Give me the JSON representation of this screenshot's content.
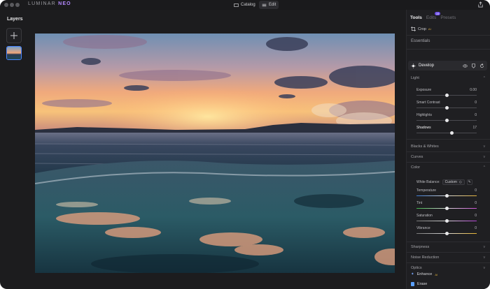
{
  "titlebar": {
    "brand_main": "LUMINAR",
    "brand_accent": "NEO",
    "catalog_label": "Catalog",
    "edit_label": "Edit"
  },
  "layers": {
    "title": "Layers"
  },
  "tabs": {
    "tools": "Tools",
    "edits": "Edits",
    "edits_badge": "15",
    "presets": "Presets"
  },
  "crop": {
    "label": "Crop",
    "ai": "AI"
  },
  "essentials": "Essentials",
  "develop": {
    "label": "Develop"
  },
  "light": {
    "title": "Light",
    "sliders": [
      {
        "label": "Exposure",
        "value": "0.00",
        "fraction": 0.5
      },
      {
        "label": "Smart Contrast",
        "value": "0",
        "fraction": 0.5
      },
      {
        "label": "Highlights",
        "value": "0",
        "fraction": 0.5
      },
      {
        "label": "Shadows",
        "value": "17",
        "fraction": 0.585
      }
    ]
  },
  "groups": {
    "blacks_whites": "Blacks & Whites",
    "curves": "Curves",
    "color": "Color",
    "sharpness": "Sharpness",
    "noise_reduction": "Noise Reduction",
    "optics": "Optics"
  },
  "color": {
    "white_balance_label": "White Balance:",
    "white_balance_value": "Custom",
    "sliders": [
      {
        "label": "Temperature",
        "value": "0",
        "fraction": 0.5
      },
      {
        "label": "Tint",
        "value": "0",
        "fraction": 0.5
      },
      {
        "label": "Saturation",
        "value": "0",
        "fraction": 0.5
      },
      {
        "label": "Vibrance",
        "value": "0",
        "fraction": 0.5
      }
    ]
  },
  "bottom": {
    "enhance": "Enhance",
    "enhance_ai": "AI",
    "erase": "Erase"
  },
  "colors": {
    "accent_purple": "#b488ff",
    "badge": "#6b4ce6",
    "selection_blue": "#4a84ff"
  }
}
